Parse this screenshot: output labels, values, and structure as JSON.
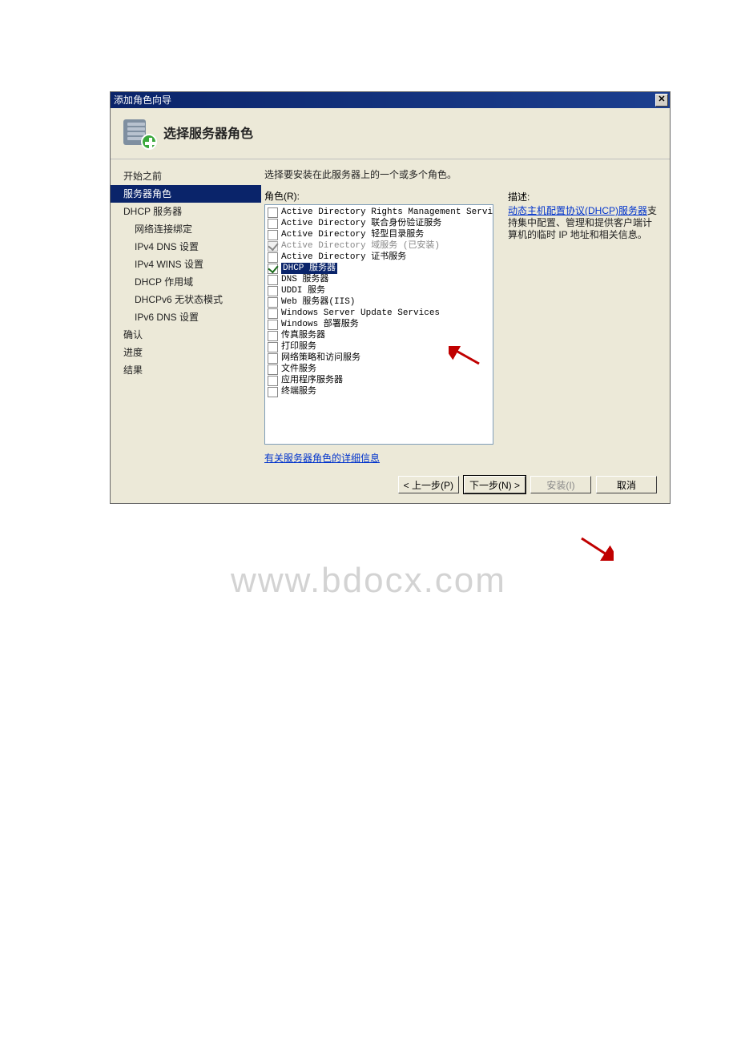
{
  "titlebar": {
    "text": "添加角色向导"
  },
  "header": {
    "title": "选择服务器角色"
  },
  "sidebar": {
    "items": [
      {
        "label": "开始之前",
        "indent": false
      },
      {
        "label": "服务器角色",
        "indent": false,
        "selected": true
      },
      {
        "label": "DHCP 服务器",
        "indent": false
      },
      {
        "label": "网络连接绑定",
        "indent": true
      },
      {
        "label": "IPv4 DNS 设置",
        "indent": true
      },
      {
        "label": "IPv4 WINS 设置",
        "indent": true
      },
      {
        "label": "DHCP 作用域",
        "indent": true
      },
      {
        "label": "DHCPv6 无状态模式",
        "indent": true
      },
      {
        "label": "IPv6 DNS 设置",
        "indent": true
      },
      {
        "label": "确认",
        "indent": false
      },
      {
        "label": "进度",
        "indent": false
      },
      {
        "label": "结果",
        "indent": false
      }
    ]
  },
  "content": {
    "instruction": "选择要安装在此服务器上的一个或多个角色。",
    "roles_label": "角色(R):",
    "more_link": "有关服务器角色的详细信息",
    "roles": [
      {
        "label": "Active Directory Rights Management Services",
        "checked": false
      },
      {
        "label": "Active Directory 联合身份验证服务",
        "checked": false
      },
      {
        "label": "Active Directory 轻型目录服务",
        "checked": false
      },
      {
        "label": "Active Directory 域服务  (已安装)",
        "checked": true,
        "disabled": true
      },
      {
        "label": "Active Directory 证书服务",
        "checked": false
      },
      {
        "label": "DHCP 服务器",
        "checked": true,
        "highlighted": true
      },
      {
        "label": "DNS 服务器",
        "checked": false
      },
      {
        "label": "UDDI 服务",
        "checked": false
      },
      {
        "label": "Web 服务器(IIS)",
        "checked": false
      },
      {
        "label": "Windows Server Update Services",
        "checked": false
      },
      {
        "label": "Windows 部署服务",
        "checked": false
      },
      {
        "label": "传真服务器",
        "checked": false
      },
      {
        "label": "打印服务",
        "checked": false
      },
      {
        "label": "网络策略和访问服务",
        "checked": false
      },
      {
        "label": "文件服务",
        "checked": false
      },
      {
        "label": "应用程序服务器",
        "checked": false
      },
      {
        "label": "终端服务",
        "checked": false
      }
    ]
  },
  "description": {
    "label": "描述:",
    "link_text": "动态主机配置协议(DHCP)服务器",
    "rest_text": "支持集中配置、管理和提供客户端计算机的临时 IP 地址和相关信息。"
  },
  "buttons": {
    "back": "< 上一步(P)",
    "next": "下一步(N) >",
    "install": "安装(I)",
    "cancel": "取消"
  },
  "watermark": "www.bdocx.com"
}
